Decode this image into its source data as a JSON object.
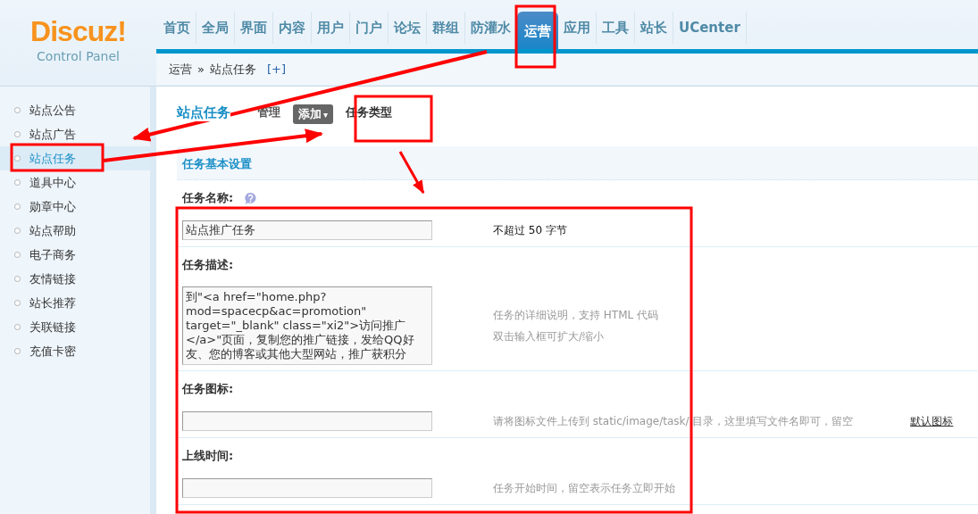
{
  "logo": {
    "name": "Discuz!",
    "subtitle": "Control Panel"
  },
  "nav": [
    {
      "label": "首页",
      "selected": false
    },
    {
      "label": "全局",
      "selected": false
    },
    {
      "label": "界面",
      "selected": false
    },
    {
      "label": "内容",
      "selected": false
    },
    {
      "label": "用户",
      "selected": false
    },
    {
      "label": "门户",
      "selected": false
    },
    {
      "label": "论坛",
      "selected": false
    },
    {
      "label": "群组",
      "selected": false
    },
    {
      "label": "防灌水",
      "selected": false
    },
    {
      "label": "运营",
      "selected": true
    },
    {
      "label": "应用",
      "selected": false
    },
    {
      "label": "工具",
      "selected": false
    },
    {
      "label": "站长",
      "selected": false
    },
    {
      "label": "UCenter",
      "selected": false
    }
  ],
  "breadcrumb": {
    "path": [
      "运营",
      "站点任务"
    ],
    "separator": "»",
    "add": "[+]"
  },
  "sidebar": [
    {
      "label": "站点公告",
      "selected": false
    },
    {
      "label": "站点广告",
      "selected": false
    },
    {
      "label": "站点任务",
      "selected": true
    },
    {
      "label": "道具中心",
      "selected": false
    },
    {
      "label": "勋章中心",
      "selected": false
    },
    {
      "label": "站点帮助",
      "selected": false
    },
    {
      "label": "电子商务",
      "selected": false
    },
    {
      "label": "友情链接",
      "selected": false
    },
    {
      "label": "站长推荐",
      "selected": false
    },
    {
      "label": "关联链接",
      "selected": false
    },
    {
      "label": "充值卡密",
      "selected": false
    }
  ],
  "page": {
    "title": "站点任务",
    "tabs": [
      {
        "label": "管理",
        "kind": "link"
      },
      {
        "label": "添加",
        "kind": "dropdown",
        "caret": "▾"
      },
      {
        "label": "任务类型",
        "kind": "plain"
      }
    ]
  },
  "section": "任务基本设置",
  "fields": [
    {
      "label": "任务名称:",
      "help": true,
      "kind": "input",
      "value": "站点推广任务",
      "hint": "不超过 50 字节",
      "emphasis": true
    },
    {
      "label": "任务描述:",
      "help": false,
      "kind": "textarea",
      "value": "到\"<a href=\"home.php?mod=spacecp&ac=promotion\" target=\"_blank\" class=\"xi2\">访问推广</a>\"页面，复制您的推广链接，发给QQ好友、您的博客或其他大型网站，推广获积分",
      "hint": "任务的详细说明，支持 HTML 代码",
      "hint_2": "双击输入框可扩大/缩小",
      "emphasis": false
    },
    {
      "label": "任务图标:",
      "help": false,
      "kind": "input",
      "hint": "请将图标文件上传到 static/image/task/ 目录，这里填写文件名即可，留空",
      "hint_link": "默认图标",
      "emphasis": false
    },
    {
      "label": "上线时间:",
      "help": false,
      "kind": "input",
      "hint": "任务开始时间，留空表示任务立即开始",
      "emphasis": false
    }
  ]
}
